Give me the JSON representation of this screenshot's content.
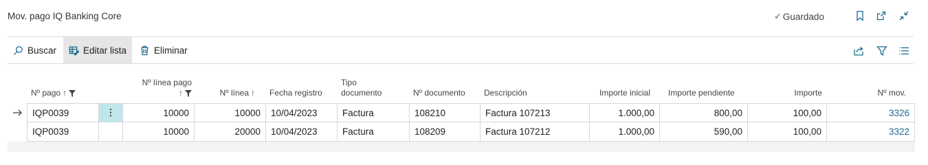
{
  "header": {
    "title": "Mov. pago IQ Banking Core",
    "status": "Guardado",
    "icons": [
      "bookmark-icon",
      "open-new-window-icon",
      "collapse-icon"
    ]
  },
  "actions": {
    "search": "Buscar",
    "edit_list": "Editar lista",
    "delete": "Eliminar",
    "right_icons": [
      "share-icon",
      "filter-icon",
      "list-view-icon"
    ]
  },
  "columns": {
    "payment_no": "Nº pago",
    "payment_line_no_l1": "Nº línea pago",
    "line_no": "Nº línea",
    "posting_date": "Fecha registro",
    "doc_type_l1": "Tipo",
    "doc_type_l2": "documento",
    "document_no": "Nº documento",
    "description": "Descripción",
    "initial_amount": "Importe inicial",
    "remaining_amount": "Importe pendiente",
    "amount": "Importe",
    "entry_no": "Nº mov."
  },
  "rows": [
    {
      "payment_no": "IQP0039",
      "payment_line_no": "10000",
      "line_no": "10000",
      "posting_date": "10/04/2023",
      "doc_type": "Factura",
      "document_no": "108210",
      "description": "Factura 107213",
      "initial_amount": "1.000,00",
      "remaining_amount": "800,00",
      "amount": "100,00",
      "entry_no": "3326"
    },
    {
      "payment_no": "IQP0039",
      "payment_line_no": "10000",
      "line_no": "20000",
      "posting_date": "10/04/2023",
      "doc_type": "Factura",
      "document_no": "108209",
      "description": "Factura 107212",
      "initial_amount": "1.000,00",
      "remaining_amount": "590,00",
      "amount": "100,00",
      "entry_no": "3322"
    }
  ],
  "colors": {
    "accent": "#1d6b8f",
    "selected_cell": "#bfe7ea",
    "active_action": "#e6e6e6"
  }
}
